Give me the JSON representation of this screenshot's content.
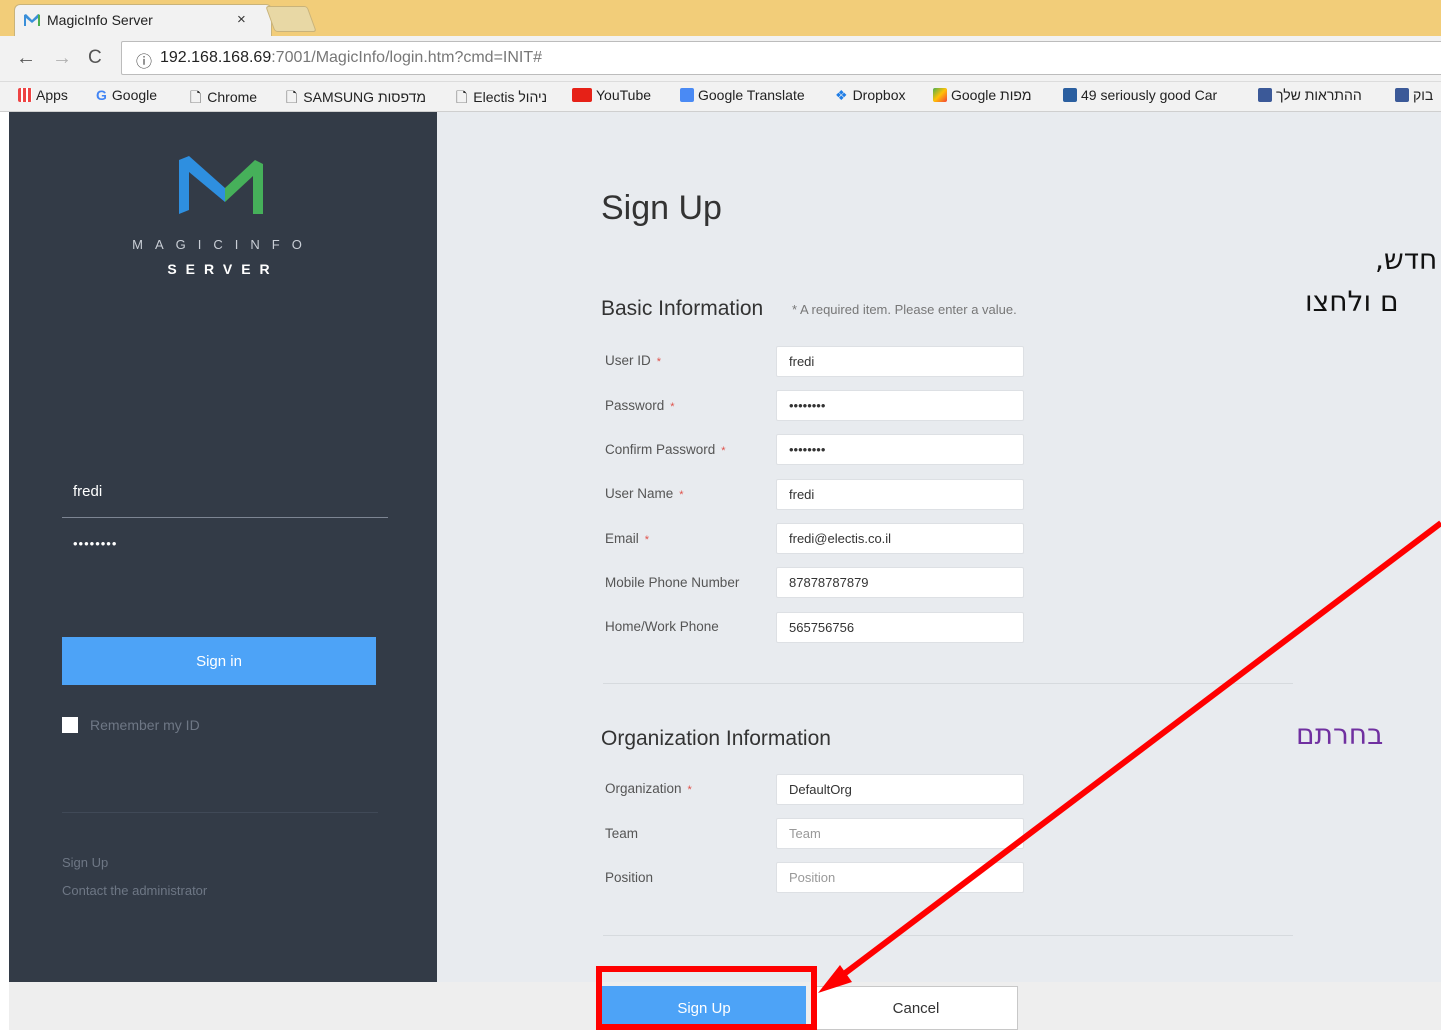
{
  "browser": {
    "tab_title": "MagicInfo Server",
    "tab_close": "×",
    "url_host": "192.168.168.69",
    "url_rest": ":7001/MagicInfo/login.htm?cmd=INIT#",
    "bookmarks": [
      "Apps",
      "Google",
      "Chrome",
      "SAMSUNG מדפסות",
      "Electis ניהול",
      "YouTube",
      "Google Translate",
      "Dropbox",
      "Google מפות",
      "49 seriously good Car",
      "ההתראות שלך",
      "בוק"
    ]
  },
  "left_panel": {
    "brand_line1": "MAGICINFO",
    "brand_line2": "SERVER",
    "username": "fredi",
    "password_mask": "••••••••",
    "signin_label": "Sign in",
    "remember_label": "Remember my ID",
    "signup_link": "Sign Up",
    "contact_link": "Contact the administrator"
  },
  "form": {
    "title": "Sign Up",
    "basic_title": "Basic Information",
    "required_note": "* A required item. Please enter a value.",
    "required_star": "*",
    "labels": {
      "user_id": "User ID",
      "password": "Password",
      "confirm_password": "Confirm Password",
      "user_name": "User Name",
      "email": "Email",
      "mobile": "Mobile Phone Number",
      "home_work": "Home/Work Phone",
      "organization": "Organization",
      "team": "Team",
      "position": "Position"
    },
    "values": {
      "user_id": "fredi",
      "password": "••••••••",
      "confirm_password": "••••••••",
      "user_name": "fredi",
      "email": "fredi@electis.co.il",
      "mobile": "87878787879",
      "home_work": "565756756",
      "organization": "DefaultOrg"
    },
    "placeholders": {
      "team": "Team",
      "position": "Position"
    },
    "org_title": "Organization Information",
    "signup_button": "Sign Up",
    "cancel_button": "Cancel"
  },
  "overlay": {
    "hebrew_line1": "חדש,",
    "hebrew_line2": "ם ולחצו",
    "hebrew_line3": "בחרתם",
    "arrow_color": "#ff0000"
  }
}
